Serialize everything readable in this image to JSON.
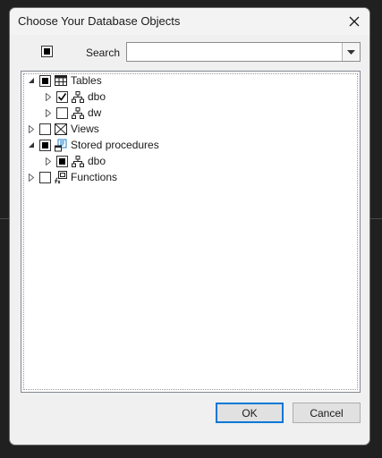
{
  "dialog": {
    "title": "Choose Your Database Objects",
    "close_icon": "close-icon"
  },
  "toolbar": {
    "select_all_state": "indeterminate",
    "search_label": "Search",
    "search_value": "",
    "search_placeholder": ""
  },
  "tree": {
    "nodes": [
      {
        "label": "Tables",
        "icon": "table-icon",
        "level": 0,
        "expander": "expanded",
        "check": "indeterminate"
      },
      {
        "label": "dbo",
        "icon": "schema-icon",
        "level": 1,
        "expander": "collapsed",
        "check": "checked"
      },
      {
        "label": "dw",
        "icon": "schema-icon",
        "level": 1,
        "expander": "collapsed",
        "check": "unchecked"
      },
      {
        "label": "Views",
        "icon": "view-icon",
        "level": 0,
        "expander": "collapsed",
        "check": "unchecked"
      },
      {
        "label": "Stored procedures",
        "icon": "stored-procedure-icon",
        "level": 0,
        "expander": "expanded",
        "check": "indeterminate"
      },
      {
        "label": "dbo",
        "icon": "schema-icon",
        "level": 1,
        "expander": "collapsed",
        "check": "indeterminate"
      },
      {
        "label": "Functions",
        "icon": "function-icon",
        "level": 0,
        "expander": "collapsed",
        "check": "unchecked"
      }
    ]
  },
  "buttons": {
    "ok_label": "OK",
    "cancel_label": "Cancel"
  },
  "colors": {
    "accent": "#0078d7",
    "dialog_bg": "#f0f0f0",
    "window_bg": "#202020"
  }
}
